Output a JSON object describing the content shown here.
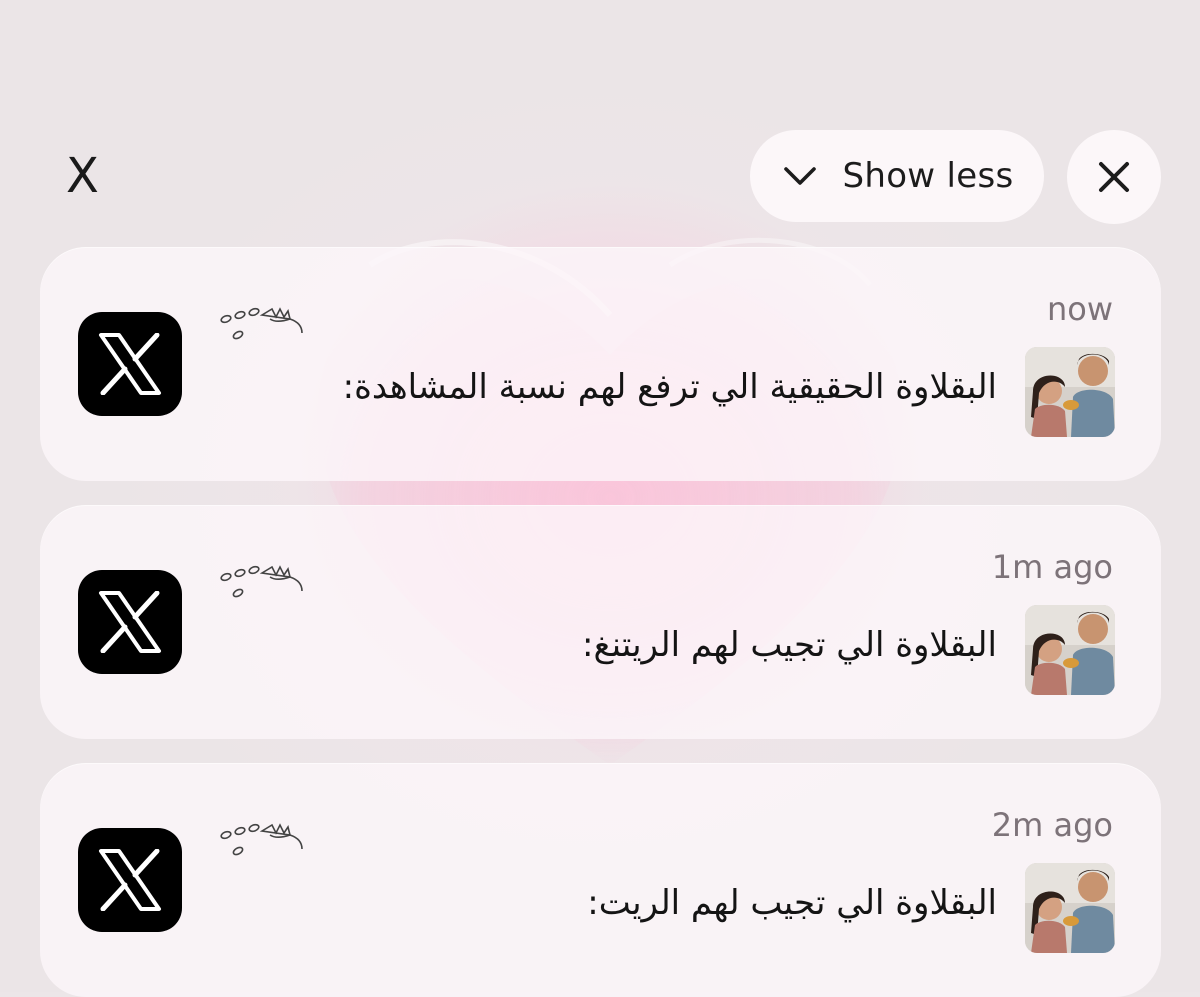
{
  "header": {
    "app_title": "X",
    "show_less_label": "Show less"
  },
  "notifications": [
    {
      "time": "now",
      "message": "البقلاوة الحقيقية الي ترفع لهم نسبة المشاهدة:"
    },
    {
      "time": "1m ago",
      "message": "البقلاوة الي تجيب لهم الريتنغ:"
    },
    {
      "time": "2m ago",
      "message": "البقلاوة الي تجيب لهم الريت:"
    }
  ],
  "icons": {
    "app": "x-logo-icon",
    "chevron": "chevron-down-icon",
    "close": "close-icon",
    "sender_decoration": "flower-doodle-icon",
    "avatar": "couple-photo-avatar"
  },
  "colors": {
    "card_background": "#fdf6fa",
    "pill_background": "#fcf8fa",
    "time_text": "#7d7379",
    "wallpaper_pink": "#fccde1"
  }
}
